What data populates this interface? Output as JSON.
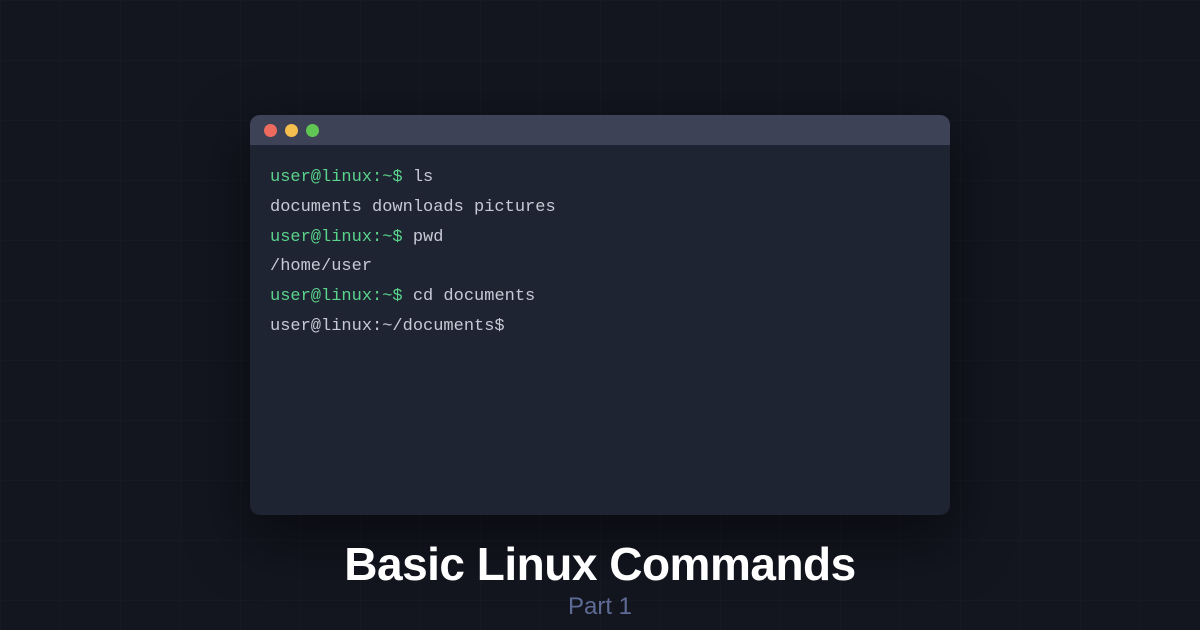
{
  "terminal": {
    "lines": [
      {
        "prompt": "user@linux:~$ ",
        "command": "ls"
      },
      {
        "output": "documents downloads pictures"
      },
      {
        "prompt": "user@linux:~$ ",
        "command": "pwd"
      },
      {
        "output": "/home/user"
      },
      {
        "prompt": "user@linux:~$ ",
        "command": "cd documents"
      },
      {
        "output": "user@linux:~/documents$"
      }
    ]
  },
  "heading": {
    "title": "Basic Linux Commands",
    "subtitle": "Part 1"
  },
  "colors": {
    "background": "#13151f",
    "terminal_bg": "#1f2433",
    "titlebar_bg": "#3d4257",
    "prompt_green": "#5ad38b",
    "text": "#c7cad5",
    "subtitle": "#5d6b95"
  }
}
